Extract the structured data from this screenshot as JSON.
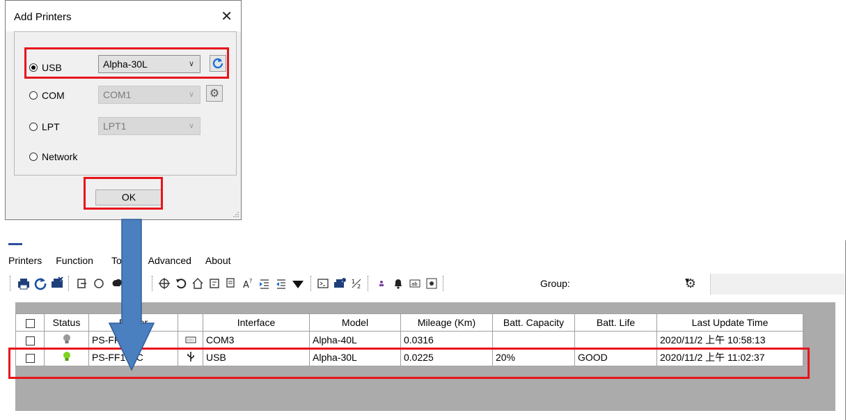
{
  "dialog": {
    "title": "Add Printers",
    "close_glyph": "✕",
    "ports": [
      {
        "label": "USB",
        "checked": true
      },
      {
        "label": "COM",
        "checked": false
      },
      {
        "label": "LPT",
        "checked": false
      },
      {
        "label": "Network",
        "checked": false
      }
    ],
    "usb_select": "Alpha-30L",
    "com_select": "COM1",
    "lpt_select": "LPT1",
    "ok_label": "OK"
  },
  "menu": [
    "Printers",
    "Function",
    "Tools",
    "Advanced",
    "About"
  ],
  "toolbar": {
    "group_label": "Group:",
    "group_value": ""
  },
  "grid": {
    "columns": [
      "",
      "Status",
      "Printer",
      "",
      "Interface",
      "Model",
      "Mileage (Km)",
      "Batt. Capacity",
      "Batt. Life",
      "Last Update Time"
    ],
    "rows": [
      {
        "status": "offline",
        "printer": "PS-FF4212",
        "interface_icon": "keyboard-icon",
        "interface": "COM3",
        "model": "Alpha-40L",
        "mileage": "0.0316",
        "capacity": "",
        "life": "",
        "updated": "2020/11/2 上午 10:58:13"
      },
      {
        "status": "online",
        "printer": "PS-FF153C",
        "interface_icon": "usb-icon",
        "interface": "USB",
        "model": "Alpha-30L",
        "mileage": "0.0225",
        "capacity": "20%",
        "life": "GOOD",
        "updated": "2020/11/2 上午 11:02:37"
      }
    ]
  },
  "colors": {
    "highlight": "#e8141b",
    "arrow": "#4a7fc0",
    "bulb_on": "#7ed321",
    "bulb_off": "#9a9a9a"
  }
}
